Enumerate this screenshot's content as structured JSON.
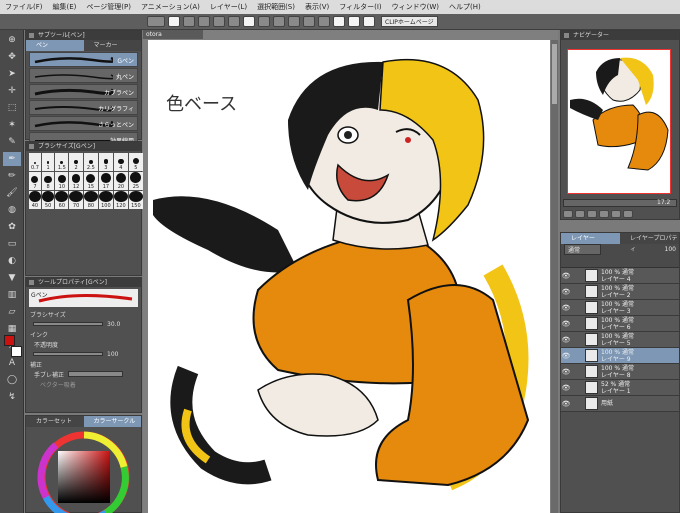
{
  "menu": [
    "ファイル(F)",
    "編集(E)",
    "ページ管理(P)",
    "アニメーション(A)",
    "レイヤー(L)",
    "選択範囲(S)",
    "表示(V)",
    "フィルター(I)",
    "ウィンドウ(W)",
    "ヘルプ(H)"
  ],
  "command_bar": {
    "clip_label": "CLIPホームページ"
  },
  "sub_tool_panel": {
    "title": "サブツール[ペン]",
    "tabs": [
      "ペン",
      "マーカー"
    ],
    "brushes": [
      "Gペン",
      "丸ペン",
      "カブラペン",
      "カリグラフィ",
      "さらっとペン",
      "効果線用"
    ]
  },
  "brush_size_panel": {
    "title": "ブラシサイズ[Gペン]",
    "sizes": [
      "0.7",
      "1",
      "1.5",
      "2",
      "2.5",
      "3",
      "4",
      "5",
      "6",
      "7",
      "8",
      "10",
      "12",
      "15",
      "17",
      "20",
      "25",
      "30",
      "40",
      "50",
      "60",
      "70",
      "80",
      "100",
      "120",
      "150",
      "170"
    ]
  },
  "tool_property": {
    "title": "ツールプロパティ[Gペン]",
    "brush_name": "Gペン",
    "brush_size_label": "ブラシサイズ",
    "brush_size_value": "30.0",
    "ink_label": "インク",
    "opacity_label": "不透明度",
    "opacity_value": "100",
    "correction_label": "補正",
    "stabilize_label": "手ブレ補正",
    "vector_label": "ベクター吸着"
  },
  "color_panel": {
    "tab1": "カラーセット",
    "tab2": "カラーサークル"
  },
  "canvas": {
    "tab_label": "otora",
    "annotation": "色ベース"
  },
  "navigator": {
    "title": "ナビゲーター",
    "zoom": "17.2"
  },
  "layer_panel": {
    "tab_label": "レイヤー",
    "tab2_label": "レイヤープロパティ",
    "blend_mode": "通常",
    "opacity": "100",
    "layers": [
      {
        "mode": "100 % 通常",
        "name": "レイヤー 4"
      },
      {
        "mode": "100 % 通常",
        "name": "レイヤー 2"
      },
      {
        "mode": "100 % 通常",
        "name": "レイヤー 3"
      },
      {
        "mode": "100 % 通常",
        "name": "レイヤー 6"
      },
      {
        "mode": "100 % 通常",
        "name": "レイヤー 5"
      },
      {
        "mode": "100 % 通常",
        "name": "レイヤー 9"
      },
      {
        "mode": "100 % 通常",
        "name": "レイヤー 8"
      },
      {
        "mode": "52 % 通常",
        "name": "レイヤー 1"
      },
      {
        "mode": "",
        "name": "用紙"
      }
    ]
  },
  "colors": {
    "accent": "#7d97b5",
    "main_color": "#cc1111",
    "hair_black": "#1a1a1a",
    "hair_yellow": "#f2c416",
    "shirt_orange": "#e58a0c",
    "skin": "#f1ebe3"
  }
}
